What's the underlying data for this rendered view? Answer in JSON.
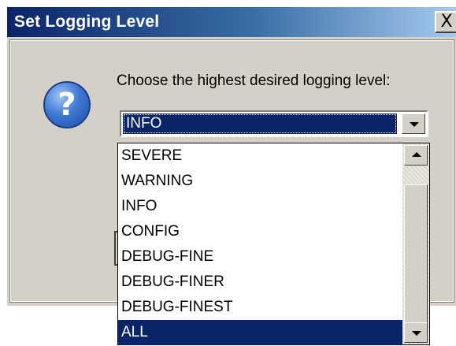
{
  "window": {
    "title": "Set Logging Level",
    "close_label": "X"
  },
  "dialog": {
    "icon": "question-icon",
    "icon_glyph": "?",
    "prompt": "Choose the highest desired logging level:"
  },
  "combo": {
    "selected": "INFO"
  },
  "dropdown": {
    "items": [
      "SEVERE",
      "WARNING",
      "INFO",
      "CONFIG",
      "DEBUG-FINE",
      "DEBUG-FINER",
      "DEBUG-FINEST",
      "ALL"
    ],
    "highlighted": "ALL"
  },
  "colors": {
    "selection": "#0a246a",
    "face": "#d4d0c8"
  }
}
